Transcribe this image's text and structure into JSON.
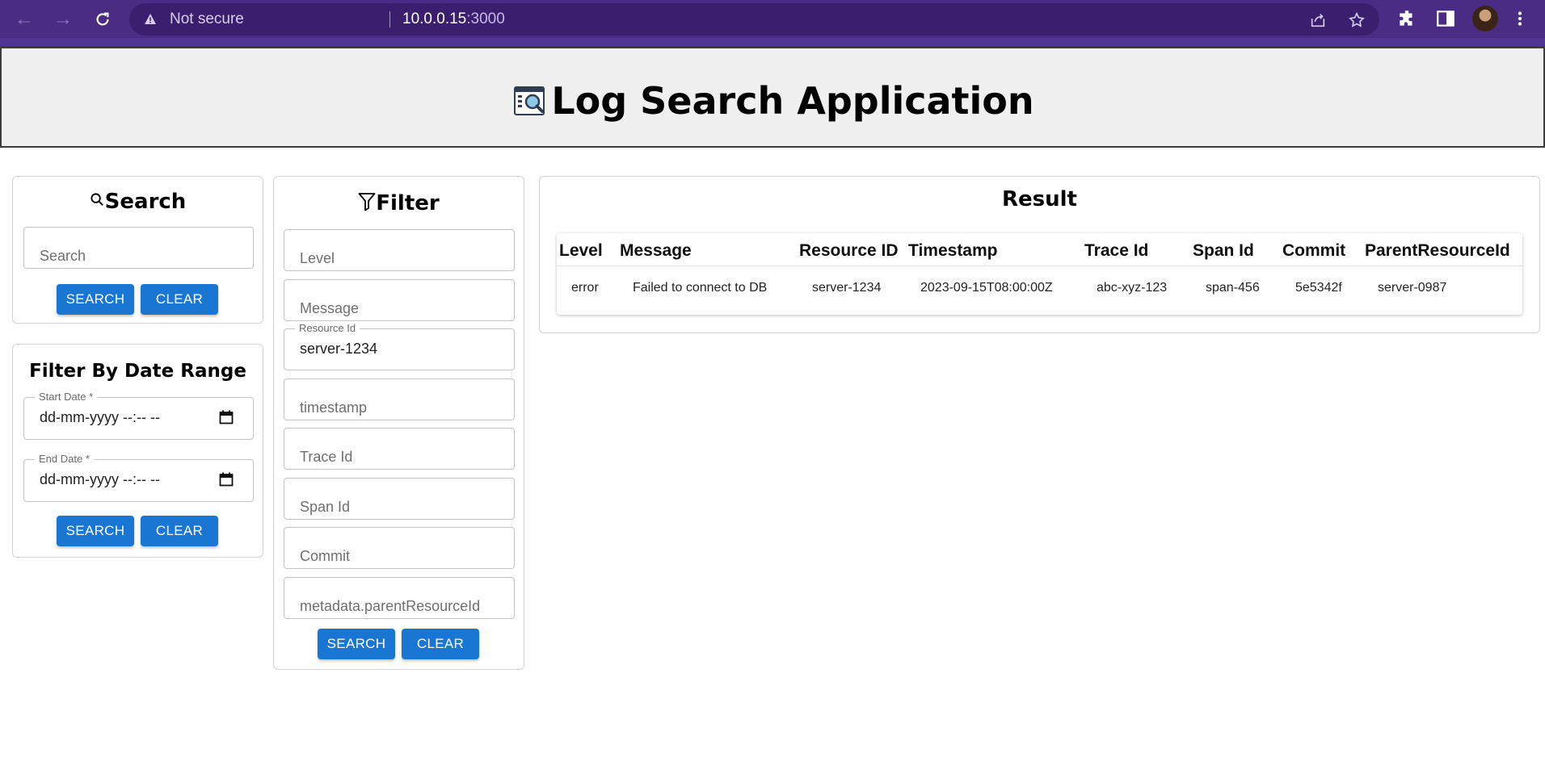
{
  "browser": {
    "security_label": "Not secure",
    "url_host": "10.0.0.15",
    "url_port": ":3000"
  },
  "header": {
    "title": "Log Search Application"
  },
  "search_panel": {
    "title": "Search",
    "placeholder": "Search",
    "search_button": "SEARCH",
    "clear_button": "CLEAR"
  },
  "date_panel": {
    "title": "Filter By Date Range",
    "start_label": "Start Date *",
    "start_value": "dd-mm-yyyy --:-- --",
    "end_label": "End Date *",
    "end_value": "dd-mm-yyyy --:-- --",
    "search_button": "SEARCH",
    "clear_button": "CLEAR"
  },
  "filter_panel": {
    "title": "Filter",
    "level_placeholder": "Level",
    "message_placeholder": "Message",
    "resource_label": "Resource Id",
    "resource_value": "server-1234",
    "timestamp_placeholder": "timestamp",
    "trace_placeholder": "Trace Id",
    "span_placeholder": "Span Id",
    "commit_placeholder": "Commit",
    "parent_placeholder": "metadata.parentResourceId",
    "search_button": "SEARCH",
    "clear_button": "CLEAR"
  },
  "result": {
    "title": "Result",
    "columns": [
      "Level",
      "Message",
      "Resource ID",
      "Timestamp",
      "Trace Id",
      "Span Id",
      "Commit",
      "ParentResourceId"
    ],
    "rows": [
      [
        "error",
        "Failed to connect to DB",
        "server-1234",
        "2023-09-15T08:00:00Z",
        "abc-xyz-123",
        "span-456",
        "5e5342f",
        "server-0987"
      ]
    ]
  },
  "colors": {
    "chrome": "#4b2c85",
    "primary_button": "#1976d2",
    "banner_bg": "#f0f0f1"
  },
  "icons": [
    "back-icon",
    "forward-icon",
    "reload-icon",
    "warning-icon",
    "share-icon",
    "star-icon",
    "extensions-icon",
    "side-panel-icon",
    "menu-icon",
    "log-app-icon",
    "search-icon",
    "filter-icon",
    "calendar-icon"
  ]
}
